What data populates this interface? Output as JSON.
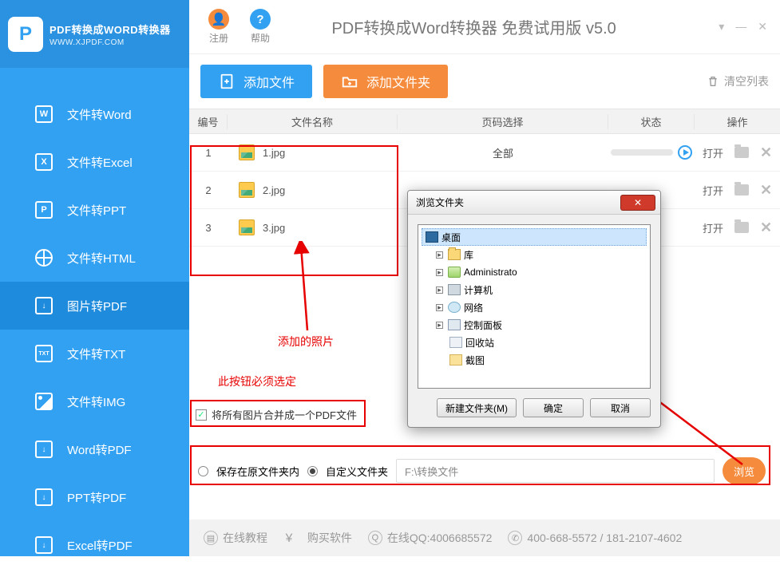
{
  "logo": {
    "title": "PDF转换成WORD转换器",
    "subtitle": "WWW.XJPDF.COM"
  },
  "titlebar": {
    "register": "注册",
    "help": "帮助",
    "title": "PDF转换成Word转换器 免费试用版 v5.0"
  },
  "nav": [
    {
      "label": "文件转Word",
      "glyph": "W"
    },
    {
      "label": "文件转Excel",
      "glyph": "X"
    },
    {
      "label": "文件转PPT",
      "glyph": "P"
    },
    {
      "label": "文件转HTML",
      "glyph": ""
    },
    {
      "label": "图片转PDF",
      "glyph": ""
    },
    {
      "label": "文件转TXT",
      "glyph": "TXT"
    },
    {
      "label": "文件转IMG",
      "glyph": ""
    },
    {
      "label": "Word转PDF",
      "glyph": ""
    },
    {
      "label": "PPT转PDF",
      "glyph": ""
    },
    {
      "label": "Excel转PDF",
      "glyph": ""
    }
  ],
  "toolbar": {
    "add_file": "添加文件",
    "add_folder": "添加文件夹",
    "clear": "清空列表"
  },
  "columns": {
    "idx": "编号",
    "name": "文件名称",
    "page": "页码选择",
    "status": "状态",
    "ops": "操作"
  },
  "rows": [
    {
      "idx": "1",
      "name": "1.jpg",
      "page": "全部",
      "open": "打开"
    },
    {
      "idx": "2",
      "name": "2.jpg",
      "page": "",
      "open": "打开"
    },
    {
      "idx": "3",
      "name": "3.jpg",
      "page": "",
      "open": "打开"
    }
  ],
  "annotations": {
    "added_photos": "添加的照片",
    "must_select": "此按钮必须选定"
  },
  "merge": {
    "label": "将所有图片合并成一个PDF文件"
  },
  "save": {
    "opt_same": "保存在原文件夹内",
    "opt_custom": "自定义文件夹",
    "path": "F:\\转换文件",
    "browse": "浏览"
  },
  "dialog": {
    "title": "浏览文件夹",
    "tree": {
      "desktop": "桌面",
      "lib": "库",
      "admin": "Administrato",
      "pc": "计算机",
      "net": "网络",
      "cp": "控制面板",
      "bin": "回收站",
      "shot": "截图"
    },
    "new_folder": "新建文件夹(M)",
    "ok": "确定",
    "cancel": "取消"
  },
  "footer": {
    "tutorial": "在线教程",
    "buy": "购买软件",
    "qq_label": "在线QQ:4006685572",
    "phone": "400-668-5572 / 181-2107-4602",
    "yen": "￥"
  }
}
